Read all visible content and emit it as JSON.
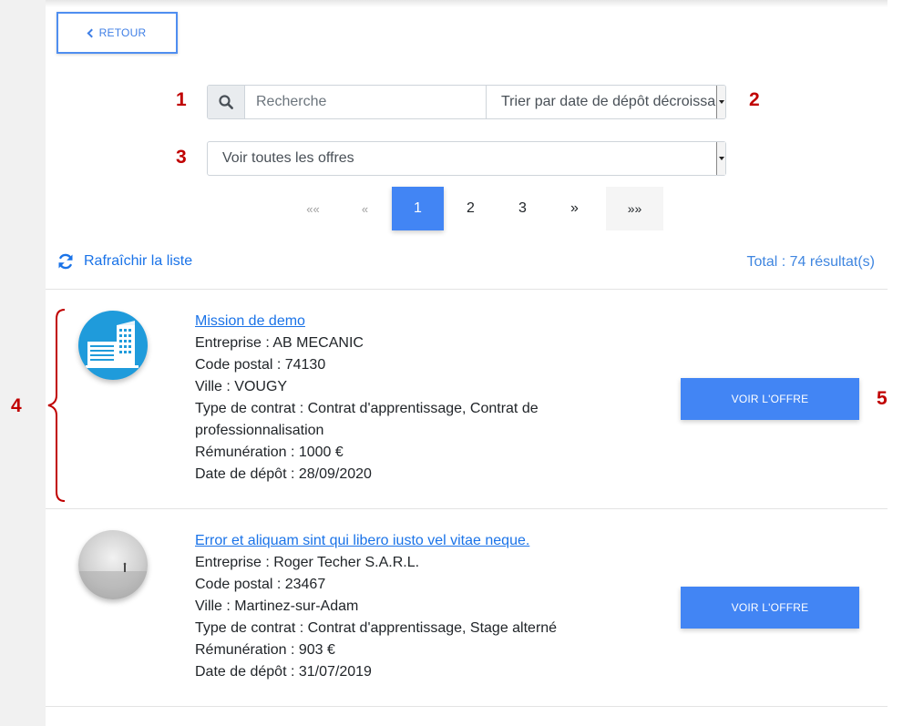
{
  "back_button": {
    "label": "RETOUR"
  },
  "markers": [
    "1",
    "2",
    "3",
    "4",
    "5"
  ],
  "search": {
    "placeholder": "Recherche",
    "value": "",
    "icon": "search-icon"
  },
  "sort_select": {
    "selected": "Trier par date de dépôt décroissant"
  },
  "filter_select": {
    "selected": "Voir toutes les offres"
  },
  "pagination": {
    "first": "««",
    "prev": "«",
    "pages": [
      "1",
      "2",
      "3"
    ],
    "current": "1",
    "next": "»",
    "last": "»»"
  },
  "refresh": {
    "label": "Rafraîchir la liste",
    "icon": "refresh-icon"
  },
  "total": "Total : 74 résultat(s)",
  "offers": [
    {
      "title": "Mission de demo",
      "lines": [
        "Entreprise : AB MECANIC",
        "Code postal : 74130",
        "Ville : VOUGY",
        "Type de contrat : Contrat d'apprentissage, Contrat de professionnalisation",
        "Rémunération : 1000 €",
        "Date de dépôt : 28/09/2020"
      ],
      "button": "VOIR L'OFFRE"
    },
    {
      "title": "Error et aliquam sint qui libero iusto vel vitae neque.",
      "lines": [
        "Entreprise : Roger Techer S.A.R.L.",
        "Code postal : 23467",
        "Ville : Martinez-sur-Adam",
        "Type de contrat : Contrat d'apprentissage, Stage alterné",
        "Rémunération : 903 €",
        "Date de dépôt : 31/07/2019"
      ],
      "button": "VOIR L'OFFRE"
    }
  ],
  "colors": {
    "primary": "#4285f4",
    "link": "#1a73e8",
    "marker": "#c00000",
    "avatar_blue": "#1f9bdb"
  }
}
